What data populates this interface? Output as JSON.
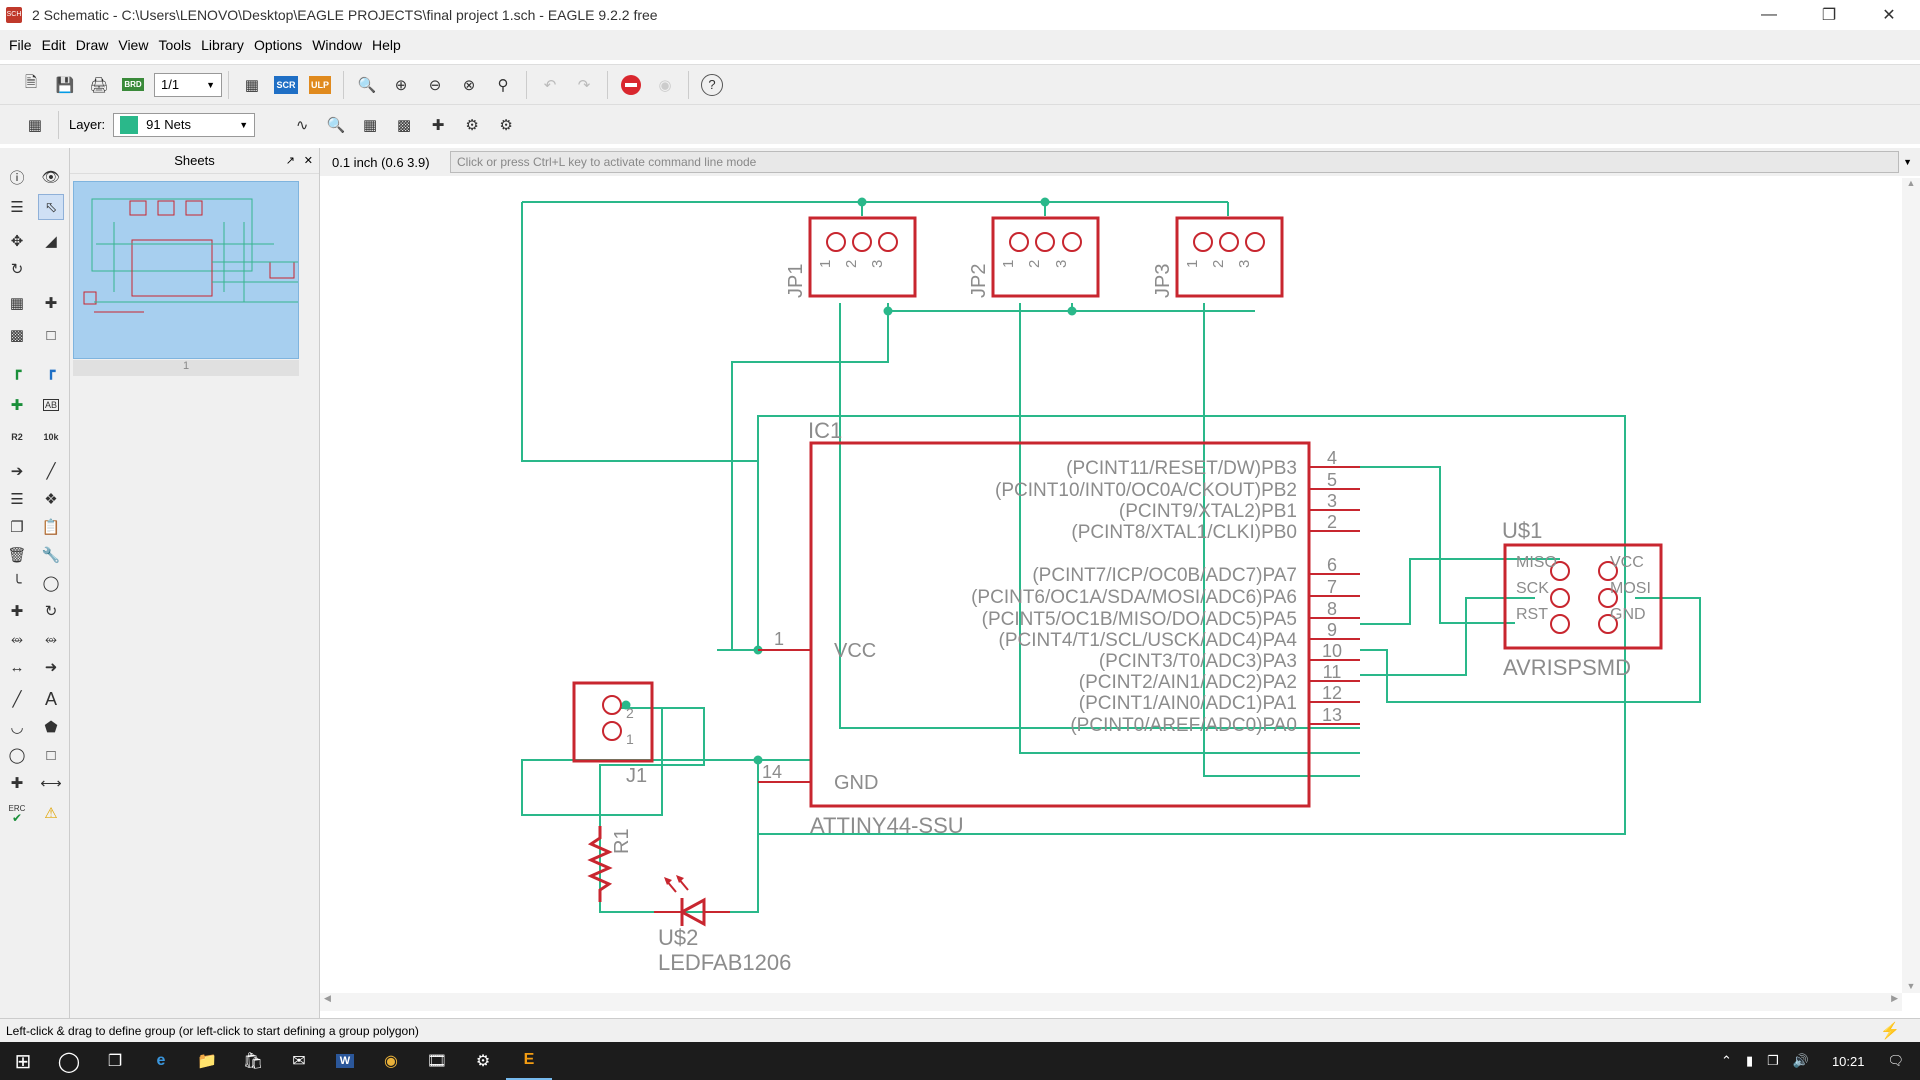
{
  "window": {
    "title": "2 Schematic - C:\\Users\\LENOVO\\Desktop\\EAGLE PROJECTS\\final project 1.sch - EAGLE 9.2.2 free",
    "app_icon_text": "SCH"
  },
  "menu": [
    "File",
    "Edit",
    "Draw",
    "View",
    "Tools",
    "Library",
    "Options",
    "Window",
    "Help"
  ],
  "toolbar": {
    "sheet_select": "1/1",
    "scr_label": "SCR",
    "ulp_label": "ULP",
    "brd_label": "BRD",
    "help_label": "?"
  },
  "layerbar": {
    "layer_label": "Layer:",
    "layer_value": "91 Nets",
    "layer_color": "#2ab88a"
  },
  "sheets": {
    "header": "Sheets",
    "sheet_number": "1"
  },
  "command": {
    "coordinate": "0.1 inch (0.6 3.9)",
    "placeholder": "Click or press Ctrl+L key to activate command line mode"
  },
  "left_tools": {
    "r2_label": "R2",
    "r2_sub": "10k",
    "abc_label": "AB",
    "text_tool": "A",
    "erc_label": "ERC"
  },
  "schematic": {
    "headers": [
      {
        "name": "JP1",
        "pins": [
          "1",
          "2",
          "3"
        ]
      },
      {
        "name": "JP2",
        "pins": [
          "1",
          "2",
          "3"
        ]
      },
      {
        "name": "JP3",
        "pins": [
          "1",
          "2",
          "3"
        ]
      }
    ],
    "ic": {
      "ref": "IC1",
      "value": "ATTINY44-SSU",
      "vcc_pin": "1",
      "vcc_label": "VCC",
      "gnd_pin": "14",
      "gnd_label": "GND",
      "pins": [
        {
          "label": "(PCINT11/RESET/DW)PB3",
          "num": "4"
        },
        {
          "label": "(PCINT10/INT0/OC0A/CKOUT)PB2",
          "num": "5"
        },
        {
          "label": "(PCINT9/XTAL2)PB1",
          "num": "3"
        },
        {
          "label": "(PCINT8/XTAL1/CLKI)PB0",
          "num": "2"
        },
        {
          "label": "(PCINT7/ICP/OC0B/ADC7)PA7",
          "num": "6"
        },
        {
          "label": "(PCINT6/OC1A/SDA/MOSI/ADC6)PA6",
          "num": "7"
        },
        {
          "label": "(PCINT5/OC1B/MISO/DO/ADC5)PA5",
          "num": "8"
        },
        {
          "label": "(PCINT4/T1/SCL/USCK/ADC4)PA4",
          "num": "9"
        },
        {
          "label": "(PCINT3/T0/ADC3)PA3",
          "num": "10"
        },
        {
          "label": "(PCINT2/AIN1/ADC2)PA2",
          "num": "11"
        },
        {
          "label": "(PCINT1/AIN0/ADC1)PA1",
          "num": "12"
        },
        {
          "label": "(PCINT0/AREF/ADC0)PA0",
          "num": "13"
        }
      ]
    },
    "isp": {
      "ref": "U$1",
      "value": "AVRISPSMD",
      "left_labels": [
        "MISO",
        "SCK",
        "RST"
      ],
      "right_labels": [
        "VCC",
        "MOSI",
        "GND"
      ]
    },
    "j1": {
      "ref": "J1",
      "pins": [
        "2",
        "1"
      ]
    },
    "r1": {
      "ref": "R1"
    },
    "led": {
      "ref": "U$2",
      "value": "LEDFAB1206"
    }
  },
  "status": {
    "message": "Left-click & drag to define group (or left-click to start defining a group polygon)"
  },
  "taskbar": {
    "time": "10:21",
    "word_label": "W",
    "e_label": "E"
  },
  "colors": {
    "net": "#2ab88a",
    "symbol": "#c8262f",
    "text": "#8c8c8c",
    "thumb_bg": "#a7cfef"
  }
}
